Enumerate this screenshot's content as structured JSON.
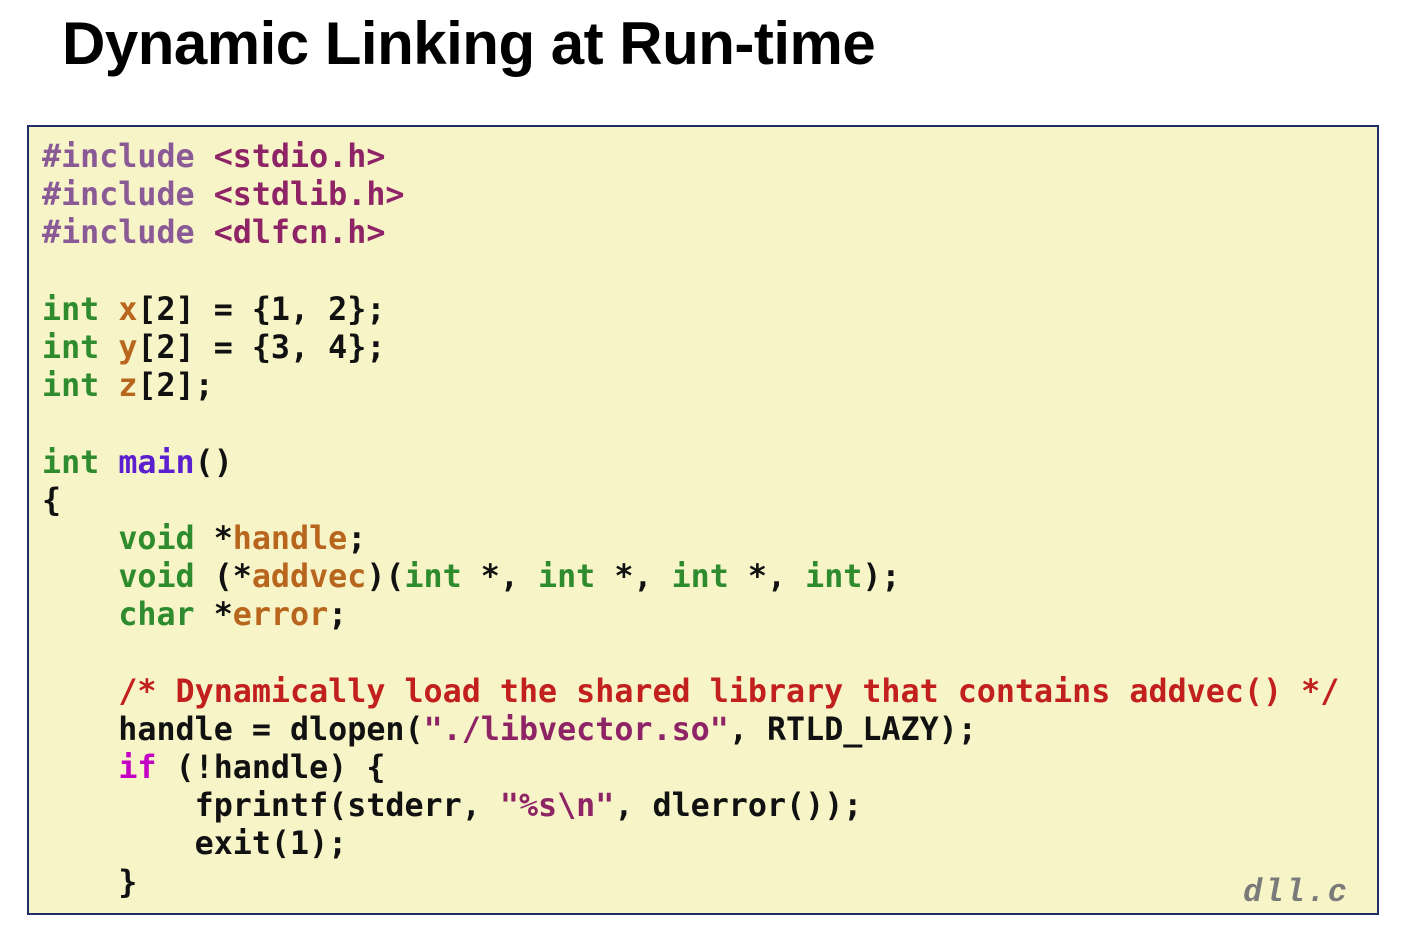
{
  "slide": {
    "title": "Dynamic Linking at Run-time"
  },
  "code": {
    "filename": "dll.c",
    "lines": [
      {
        "spans": [
          {
            "t": "#include ",
            "c": "pp"
          },
          {
            "t": "<stdio.h>",
            "c": "hdr"
          }
        ]
      },
      {
        "spans": [
          {
            "t": "#include ",
            "c": "pp"
          },
          {
            "t": "<stdlib.h>",
            "c": "hdr"
          }
        ]
      },
      {
        "spans": [
          {
            "t": "#include ",
            "c": "pp"
          },
          {
            "t": "<dlfcn.h>",
            "c": "hdr"
          }
        ]
      },
      {
        "spans": []
      },
      {
        "spans": [
          {
            "t": "int ",
            "c": "ty"
          },
          {
            "t": "x",
            "c": "var"
          },
          {
            "t": "[2] = {1, 2};",
            "c": ""
          }
        ]
      },
      {
        "spans": [
          {
            "t": "int ",
            "c": "ty"
          },
          {
            "t": "y",
            "c": "var"
          },
          {
            "t": "[2] = {3, 4};",
            "c": ""
          }
        ]
      },
      {
        "spans": [
          {
            "t": "int ",
            "c": "ty"
          },
          {
            "t": "z",
            "c": "var"
          },
          {
            "t": "[2];",
            "c": ""
          }
        ]
      },
      {
        "spans": []
      },
      {
        "spans": [
          {
            "t": "int ",
            "c": "ty"
          },
          {
            "t": "main",
            "c": "fn"
          },
          {
            "t": "()",
            "c": ""
          }
        ]
      },
      {
        "spans": [
          {
            "t": "{",
            "c": ""
          }
        ]
      },
      {
        "spans": [
          {
            "t": "    ",
            "c": ""
          },
          {
            "t": "void",
            "c": "ty"
          },
          {
            "t": " *",
            "c": ""
          },
          {
            "t": "handle",
            "c": "var"
          },
          {
            "t": ";",
            "c": ""
          }
        ]
      },
      {
        "spans": [
          {
            "t": "    ",
            "c": ""
          },
          {
            "t": "void",
            "c": "ty"
          },
          {
            "t": " (*",
            "c": ""
          },
          {
            "t": "addvec",
            "c": "var"
          },
          {
            "t": ")(",
            "c": ""
          },
          {
            "t": "int",
            "c": "ty"
          },
          {
            "t": " *, ",
            "c": ""
          },
          {
            "t": "int",
            "c": "ty"
          },
          {
            "t": " *, ",
            "c": ""
          },
          {
            "t": "int",
            "c": "ty"
          },
          {
            "t": " *, ",
            "c": ""
          },
          {
            "t": "int",
            "c": "ty"
          },
          {
            "t": ");",
            "c": ""
          }
        ]
      },
      {
        "spans": [
          {
            "t": "    ",
            "c": ""
          },
          {
            "t": "char",
            "c": "ty"
          },
          {
            "t": " *",
            "c": ""
          },
          {
            "t": "error",
            "c": "var"
          },
          {
            "t": ";",
            "c": ""
          }
        ]
      },
      {
        "spans": []
      },
      {
        "spans": [
          {
            "t": "    ",
            "c": ""
          },
          {
            "t": "/* Dynamically load the shared library that contains addvec() */",
            "c": "cm"
          }
        ]
      },
      {
        "spans": [
          {
            "t": "    handle = dlopen(",
            "c": ""
          },
          {
            "t": "\"./libvector.so\"",
            "c": "str"
          },
          {
            "t": ", RTLD_LAZY);",
            "c": ""
          }
        ]
      },
      {
        "spans": [
          {
            "t": "    ",
            "c": ""
          },
          {
            "t": "if",
            "c": "kw"
          },
          {
            "t": " (!handle) {",
            "c": ""
          }
        ]
      },
      {
        "spans": [
          {
            "t": "        fprintf(stderr, ",
            "c": ""
          },
          {
            "t": "\"%s\\n\"",
            "c": "str"
          },
          {
            "t": ", dlerror());",
            "c": ""
          }
        ]
      },
      {
        "spans": [
          {
            "t": "        exit(1);",
            "c": ""
          }
        ]
      },
      {
        "spans": [
          {
            "t": "    }",
            "c": ""
          }
        ]
      }
    ]
  }
}
